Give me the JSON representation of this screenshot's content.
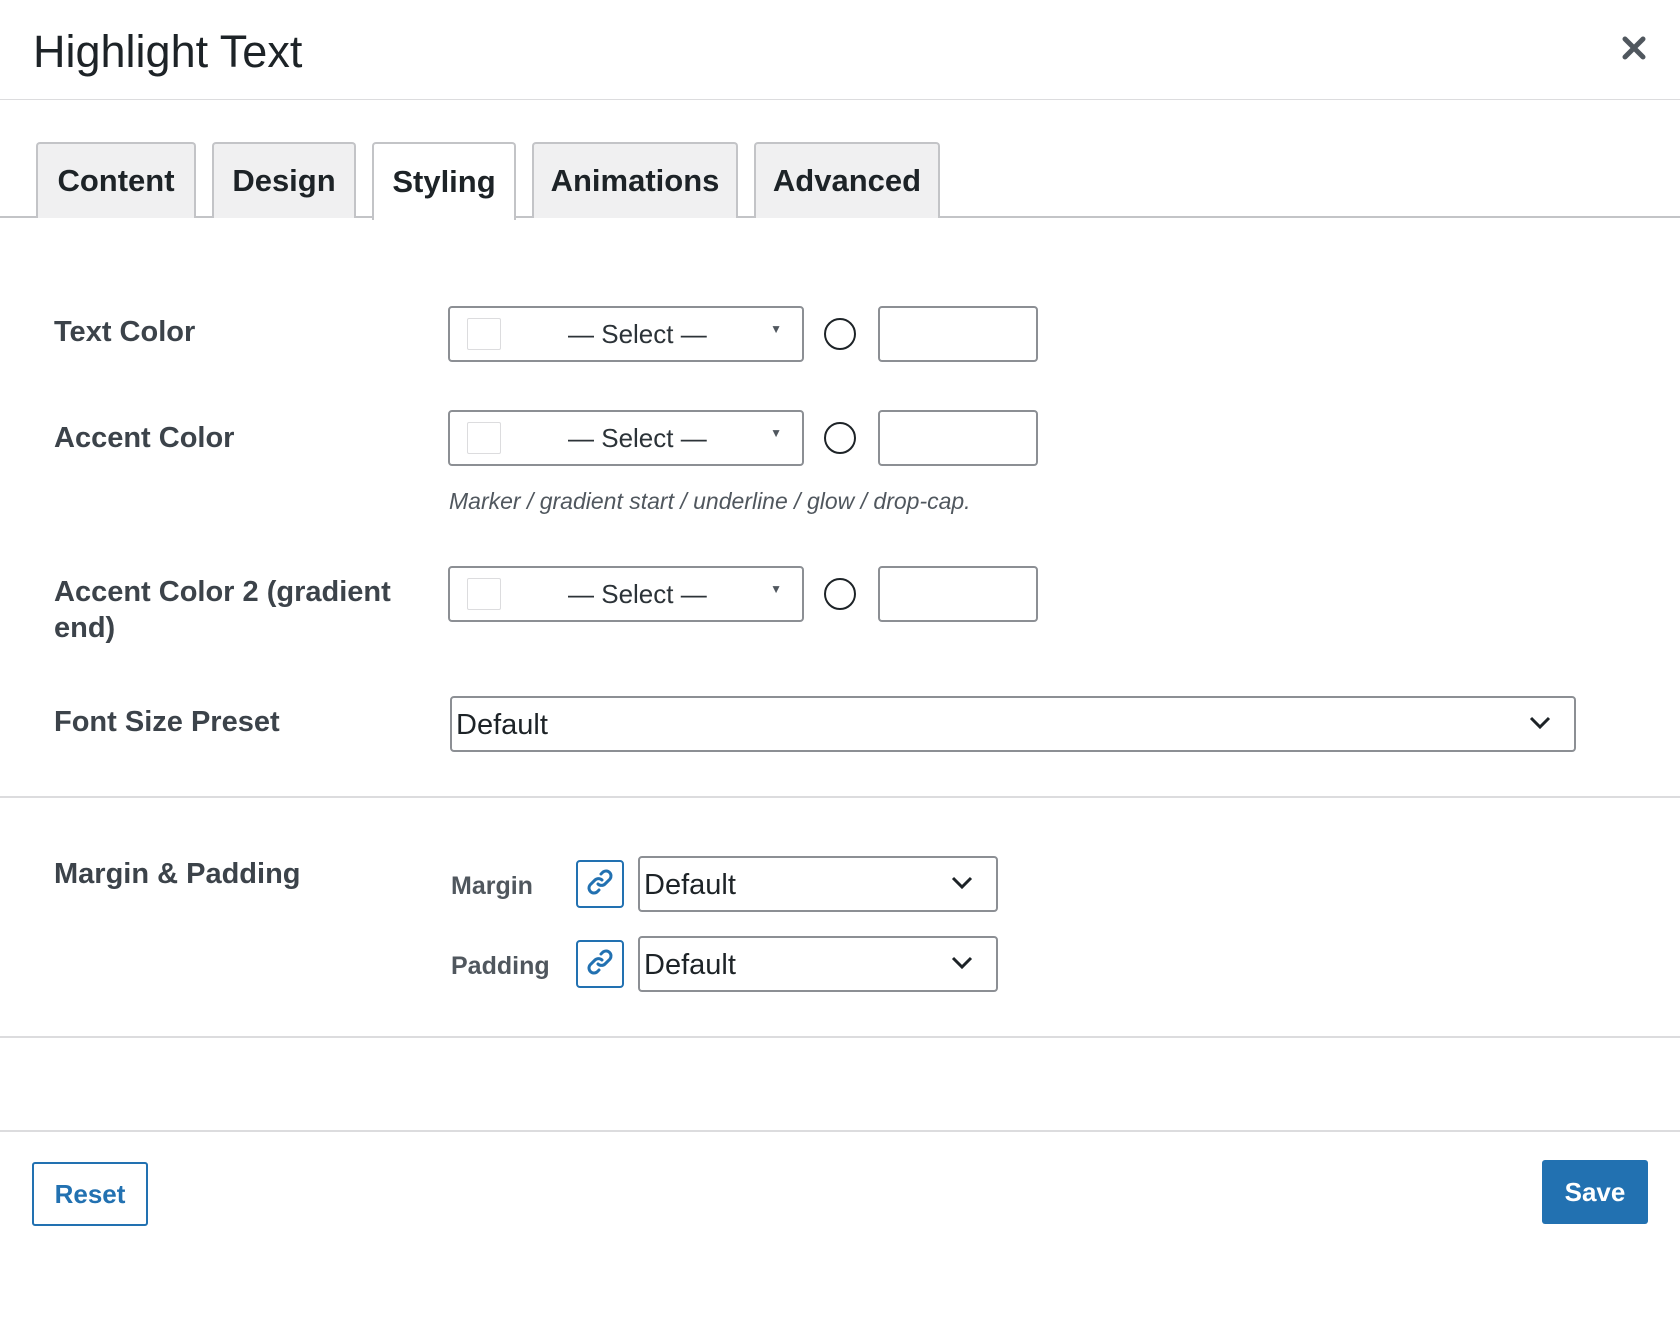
{
  "modal": {
    "title": "Highlight Text",
    "close_icon": "close-icon"
  },
  "tabs": [
    {
      "label": "Content",
      "active": false
    },
    {
      "label": "Design",
      "active": false
    },
    {
      "label": "Styling",
      "active": true
    },
    {
      "label": "Animations",
      "active": false
    },
    {
      "label": "Advanced",
      "active": false
    }
  ],
  "fields": {
    "text_color": {
      "label": "Text Color",
      "select_text": "— Select —",
      "hex_value": ""
    },
    "accent_color": {
      "label": "Accent Color",
      "select_text": "— Select —",
      "hex_value": "",
      "help": "Marker / gradient start / underline / glow / drop-cap."
    },
    "accent_color_2": {
      "label_line1": "Accent Color 2 (gradient",
      "label_line2": "end)",
      "select_text": "— Select —",
      "hex_value": ""
    },
    "font_size_preset": {
      "label": "Font Size Preset",
      "value": "Default"
    },
    "margin_padding": {
      "label": "Margin & Padding",
      "margin_label": "Margin",
      "margin_value": "Default",
      "padding_label": "Padding",
      "padding_value": "Default",
      "link_icon": "link-icon"
    }
  },
  "footer": {
    "reset_label": "Reset",
    "save_label": "Save"
  },
  "colors": {
    "accent": "#2271b1",
    "border": "#8c8f94",
    "text": "#1d2327"
  }
}
